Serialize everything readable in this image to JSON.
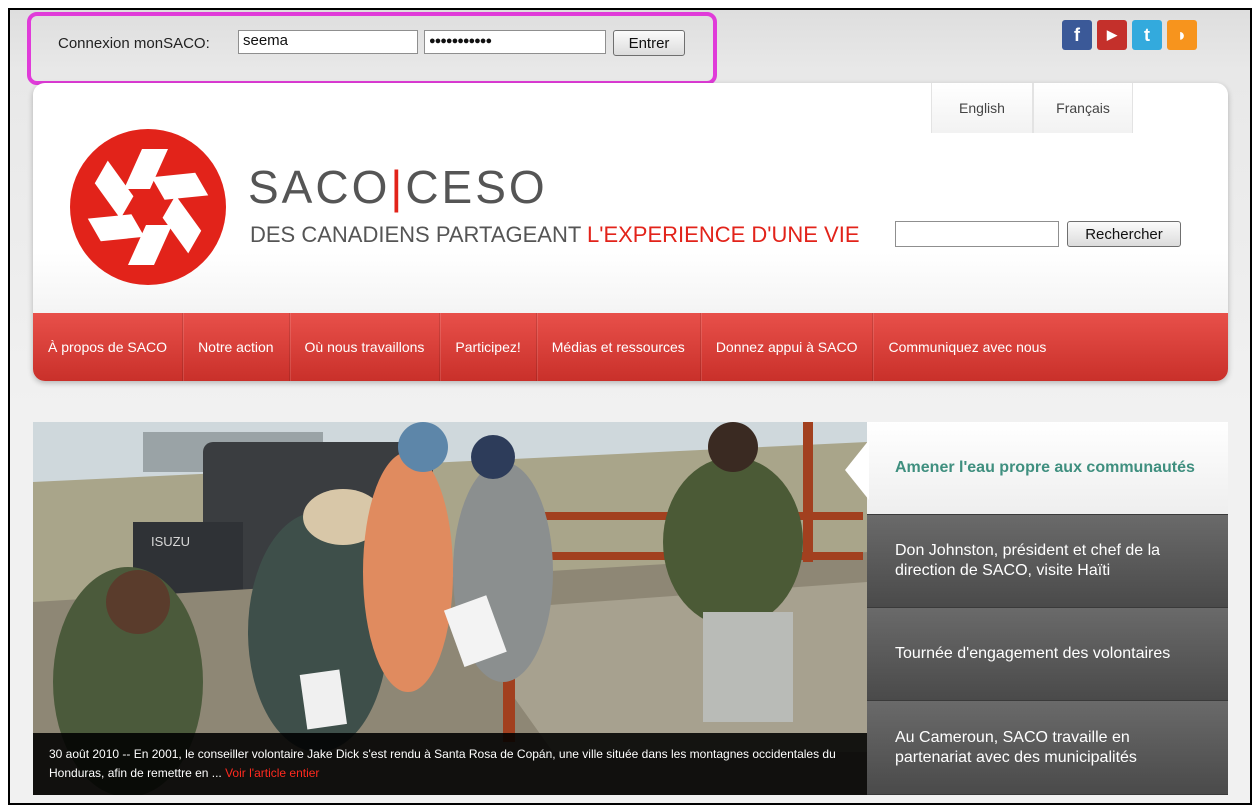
{
  "login": {
    "label": "Connexion monSACO:",
    "username": "seema",
    "password": "●●●●●●●●●●●",
    "submit_label": "Entrer"
  },
  "social": {
    "facebook_glyph": "f",
    "youtube_glyph": "▶",
    "twitter_glyph": "t",
    "rss_glyph": "◗"
  },
  "header": {
    "lang_en": "English",
    "lang_fr": "Français",
    "brand_left": "SACO",
    "brand_sep": "|",
    "brand_right": "CESO",
    "tagline_grey": "DES CANADIENS PARTAGEANT ",
    "tagline_red": "L'EXPERIENCE D'UNE VIE",
    "search_button": "Rechercher"
  },
  "nav": [
    "À propos de SACO",
    "Notre action",
    "Où nous travaillons",
    "Participez!",
    "Médias et ressources",
    "Donnez appui à SACO",
    "Communiquez avec nous"
  ],
  "feature": {
    "caption": "30 août 2010 -- En 2001, le conseiller volontaire Jake Dick s'est rendu à Santa Rosa de Copán, une ville située dans les montagnes occidentales du Honduras, afin de remettre en ... ",
    "more_link": "Voir l'article entier",
    "truck_label": "ISUZU"
  },
  "side": [
    "Amener l'eau propre aux communautés",
    "Don Johnston, président et chef de la direction de SACO, visite Haïti",
    "Tournée d'engagement des volontaires",
    "Au Cameroun, SACO travaille en partenariat avec des municipalités"
  ],
  "colors": {
    "brand_red": "#e2231a",
    "highlight": "#e03bd9",
    "active_teal": "#3f8f7f"
  }
}
